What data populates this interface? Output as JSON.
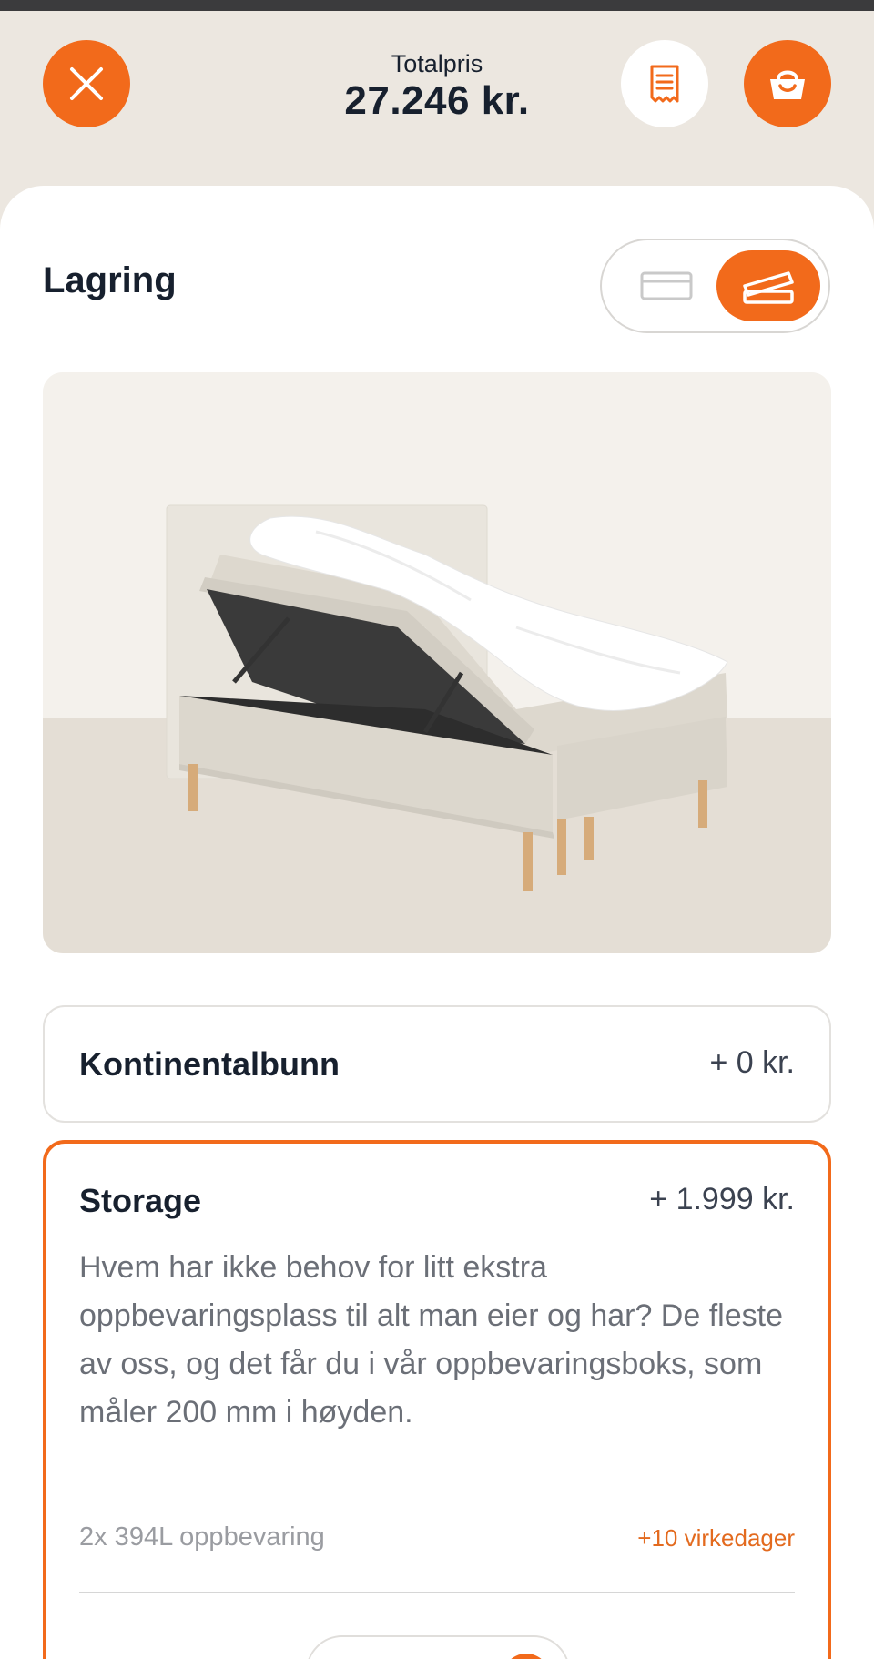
{
  "header": {
    "total_label": "Totalpris",
    "total_value": "27.246 kr.",
    "close_icon": "close-icon",
    "receipt_icon": "receipt-icon",
    "basket_icon": "basket-icon"
  },
  "section": {
    "title": "Lagring",
    "toggle": [
      {
        "icon": "bed-closed-icon",
        "selected": false
      },
      {
        "icon": "bed-storage-open-icon",
        "selected": true
      }
    ]
  },
  "options": [
    {
      "name": "Kontinentalbunn",
      "price": "+ 0 kr.",
      "selected": false
    },
    {
      "name": "Storage",
      "price": "+ 1.999 kr.",
      "description": "Hvem har ikke behov for litt ekstra oppbevaringsplass til alt man eier og har? De fleste av oss, og det får du i vår oppbevaringsboks, som måler 200 mm i høyden.",
      "spec": "2x 394L oppbevaring",
      "delivery": "+10 virkedager",
      "selected": true
    }
  ],
  "colors": {
    "accent": "#f26a1b",
    "header_bg": "#ece7e0",
    "text_dark": "#17202e"
  }
}
